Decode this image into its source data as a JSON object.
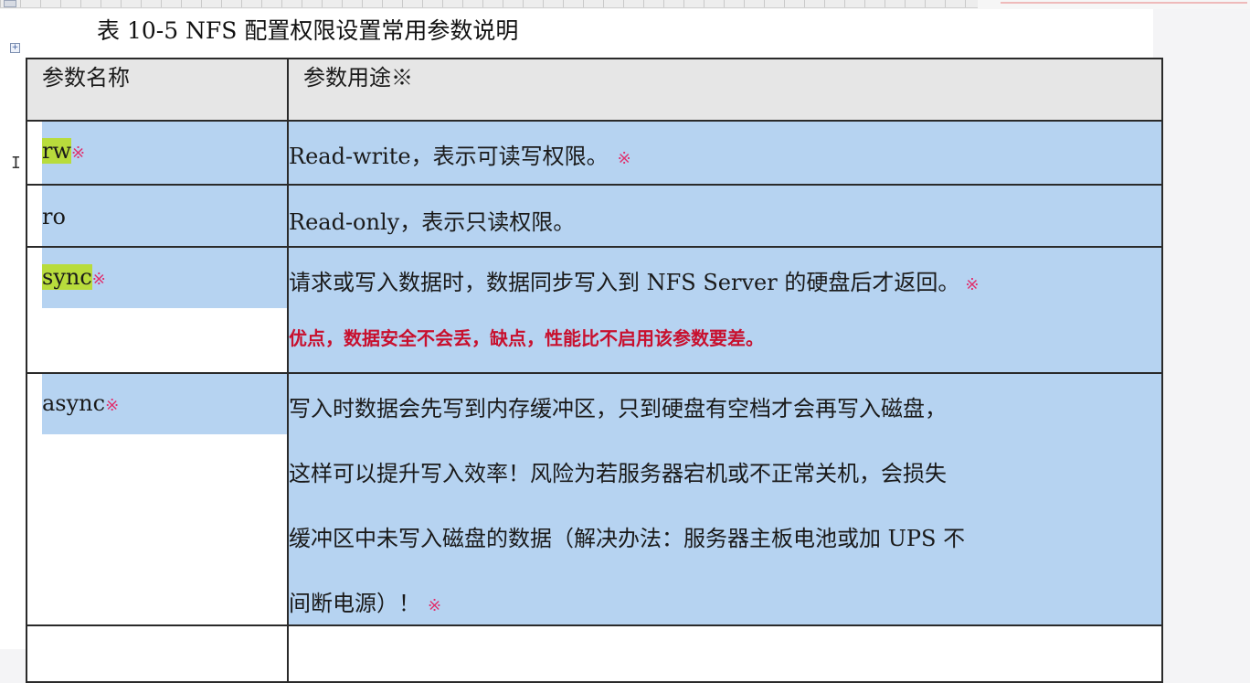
{
  "caption": "表 10-5 NFS 配置权限设置常用参数说明",
  "mark": "※",
  "headers": {
    "name": "参数名称",
    "usage": "参数用途※"
  },
  "rows": [
    {
      "name": "rw",
      "lines": [
        "Read-write，表示可读写权限。"
      ]
    },
    {
      "name": "ro",
      "lines": [
        "Read-only，表示只读权限。"
      ]
    },
    {
      "name": "sync",
      "lines": [
        "请求或写入数据时，数据同步写入到 NFS Server 的硬盘后才返回。"
      ],
      "note": "优点，数据安全不会丢，缺点，性能比不启用该参数要差。"
    },
    {
      "name": "async",
      "lines": [
        "写入时数据会先写到内存缓冲区，只到硬盘有空档才会再写入磁盘，",
        "这样可以提升写入效率！风险为若服务器宕机或不正常关机，会损失",
        "缓冲区中未写入磁盘的数据（解决办法：服务器主板电池或加 UPS 不",
        "间断电源）！"
      ]
    }
  ]
}
